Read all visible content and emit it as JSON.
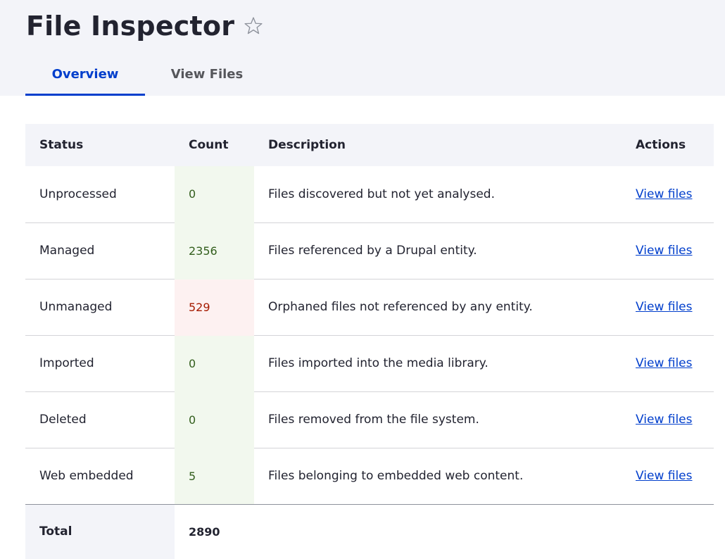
{
  "header": {
    "title": "File Inspector",
    "star": "☆"
  },
  "tabs": [
    {
      "label": "Overview",
      "active": true
    },
    {
      "label": "View Files",
      "active": false
    }
  ],
  "table": {
    "columns": [
      "Status",
      "Count",
      "Description",
      "Actions"
    ],
    "rows": [
      {
        "status": "Unprocessed",
        "count": "0",
        "description": "Files discovered but not yet analysed.",
        "action": "View files",
        "state": "ok"
      },
      {
        "status": "Managed",
        "count": "2356",
        "description": "Files referenced by a Drupal entity.",
        "action": "View files",
        "state": "ok"
      },
      {
        "status": "Unmanaged",
        "count": "529",
        "description": "Orphaned files not referenced by any entity.",
        "action": "View files",
        "state": "error"
      },
      {
        "status": "Imported",
        "count": "0",
        "description": "Files imported into the media library.",
        "action": "View files",
        "state": "ok"
      },
      {
        "status": "Deleted",
        "count": "0",
        "description": "Files removed from the file system.",
        "action": "View files",
        "state": "ok"
      },
      {
        "status": "Web embedded",
        "count": "5",
        "description": "Files belonging to embedded web content.",
        "action": "View files",
        "state": "ok"
      }
    ],
    "total": {
      "label": "Total",
      "count": "2890"
    }
  },
  "colors": {
    "accent": "#003ecc",
    "ok_bg": "#f2f8ee",
    "ok_text": "#325e1c",
    "error_bg": "#fdf1f1",
    "error_text": "#a51b00",
    "header_bg": "#f3f4f9"
  },
  "icons": {
    "star": "star-outline-icon"
  }
}
